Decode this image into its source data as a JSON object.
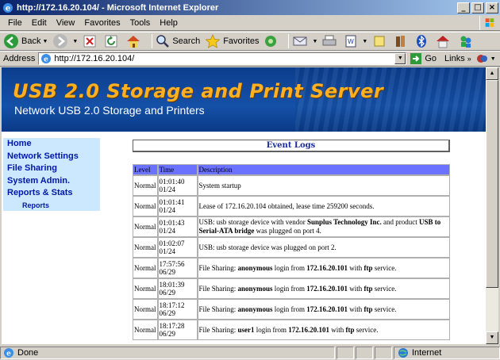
{
  "window": {
    "title": "http://172.16.20.104/ - Microsoft Internet Explorer"
  },
  "menu": [
    "File",
    "Edit",
    "View",
    "Favorites",
    "Tools",
    "Help"
  ],
  "toolbar": {
    "back_label": "Back",
    "search_label": "Search",
    "favorites_label": "Favorites"
  },
  "address": {
    "label": "Address",
    "url": "http://172.16.20.104/",
    "go_label": "Go",
    "links_label": "Links"
  },
  "banner": {
    "title": "USB 2.0 Storage and Print Server",
    "subtitle": "Network USB 2.0 Storage and Printers"
  },
  "nav": {
    "items": [
      "Home",
      "Network Settings",
      "File Sharing",
      "System Admin.",
      "Reports & Stats"
    ],
    "sub": "Reports"
  },
  "panel": {
    "title": "Event Logs"
  },
  "table": {
    "headers": [
      "Level",
      "Time",
      "Description"
    ],
    "rows": [
      {
        "level": "Normal",
        "time": "01:01:40",
        "date": "01/24",
        "parts": [
          [
            "System startup",
            false
          ]
        ]
      },
      {
        "level": "Normal",
        "time": "01:01:41",
        "date": "01/24",
        "parts": [
          [
            "Lease of 172.16.20.104 obtained, lease time 259200 seconds.",
            false
          ]
        ]
      },
      {
        "level": "Normal",
        "time": "01:01:43",
        "date": "01/24",
        "parts": [
          [
            "USB: usb storage device with vendor ",
            false
          ],
          [
            "Sunplus Technology Inc.",
            true
          ],
          [
            " and product ",
            false
          ],
          [
            "USB to Serial-ATA bridge",
            true
          ],
          [
            " was plugged on port 4.",
            false
          ]
        ]
      },
      {
        "level": "Normal",
        "time": "01:02:07",
        "date": "01/24",
        "parts": [
          [
            "USB: usb storage device was plugged on port 2.",
            false
          ]
        ]
      },
      {
        "level": "Normal",
        "time": "17:57:56",
        "date": "06/29",
        "parts": [
          [
            "File Sharing: ",
            false
          ],
          [
            "anonymous",
            true
          ],
          [
            " login from ",
            false
          ],
          [
            "172.16.20.101",
            true
          ],
          [
            " with ",
            false
          ],
          [
            "ftp",
            true
          ],
          [
            " service.",
            false
          ]
        ]
      },
      {
        "level": "Normal",
        "time": "18:01:39",
        "date": "06/29",
        "parts": [
          [
            "File Sharing: ",
            false
          ],
          [
            "anonymous",
            true
          ],
          [
            " login from ",
            false
          ],
          [
            "172.16.20.101",
            true
          ],
          [
            " with ",
            false
          ],
          [
            "ftp",
            true
          ],
          [
            " service.",
            false
          ]
        ]
      },
      {
        "level": "Normal",
        "time": "18:17:12",
        "date": "06/29",
        "parts": [
          [
            "File Sharing: ",
            false
          ],
          [
            "anonymous",
            true
          ],
          [
            " login from ",
            false
          ],
          [
            "172.16.20.101",
            true
          ],
          [
            " with ",
            false
          ],
          [
            "ftp",
            true
          ],
          [
            " service.",
            false
          ]
        ]
      },
      {
        "level": "Normal",
        "time": "18:17:28",
        "date": "06/29",
        "parts": [
          [
            "File Sharing: ",
            false
          ],
          [
            "user1",
            true
          ],
          [
            " login from ",
            false
          ],
          [
            "172.16.20.101",
            true
          ],
          [
            " with ",
            false
          ],
          [
            "ftp",
            true
          ],
          [
            " service.",
            false
          ]
        ]
      }
    ]
  },
  "status": {
    "left": "Done",
    "zone": "Internet"
  },
  "colors": {
    "title_bar": "#0a246a",
    "banner_bg": "#1551a8",
    "banner_title": "#ffb020",
    "nav_bg": "#cce8ff",
    "nav_text": "#0018a8",
    "table_header": "#6a72ff"
  }
}
